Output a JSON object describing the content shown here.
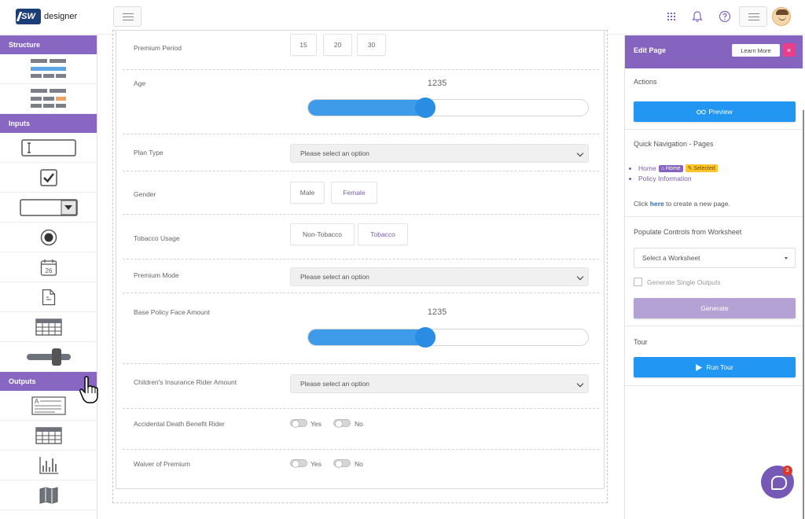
{
  "app": {
    "logo_mark": "SW",
    "logo_text": "designer"
  },
  "toolbox": {
    "sections": {
      "structure": "Structure",
      "inputs": "Inputs",
      "outputs": "Outputs"
    },
    "items": {
      "date_day": "26"
    }
  },
  "form": {
    "premium_period": {
      "label": "Premium Period",
      "options": [
        "15",
        "20",
        "30"
      ]
    },
    "age": {
      "label": "Age",
      "value": "1235",
      "fill_fraction": 0.4
    },
    "plan_type": {
      "label": "Plan Type",
      "placeholder": "Please select an option"
    },
    "gender": {
      "label": "Gender",
      "options": [
        "Male",
        "Female"
      ]
    },
    "tobacco": {
      "label": "Tobacco Usage",
      "options": [
        "Non-Tobacco",
        "Tobacco"
      ]
    },
    "premium_mode": {
      "label": "Premium Mode",
      "placeholder": "Please select an option"
    },
    "face_amount": {
      "label": "Base Policy Face Amount",
      "value": "1235",
      "fill_fraction": 0.4
    },
    "children_rider": {
      "label": "Children's Insurance Rider Amount",
      "placeholder": "Please select an option"
    },
    "accidental_death": {
      "label": "Accidental Death Benefit Rider",
      "yes": "Yes",
      "no": "No"
    },
    "waiver": {
      "label": "Waiver of Premium",
      "yes": "Yes",
      "no": "No"
    }
  },
  "panel": {
    "title": "Edit Page",
    "learn_more": "Learn More",
    "close": "×",
    "actions": {
      "title": "Actions",
      "preview": "Preview"
    },
    "quick_nav": {
      "title": "Quick Navigation - Pages",
      "pages": [
        {
          "label": "Home",
          "home_badge": "Home",
          "selected_badge": "Selected"
        },
        {
          "label": "Policy Information"
        }
      ],
      "create_prefix": "Click ",
      "create_link": "here",
      "create_suffix": " to create a new page."
    },
    "populate": {
      "title": "Populate Controls from Worksheet",
      "select_placeholder": "Select a Worksheet",
      "checkbox_label": "Generate Single Outputs",
      "generate": "Generate"
    },
    "tour": {
      "title": "Tour",
      "run": "Run Tour"
    }
  },
  "chat": {
    "unread": "3"
  },
  "colors": {
    "purple": "#8464bf",
    "blue": "#2196f3",
    "slider_blue": "#3d9be9",
    "badge_yellow": "#ffc52b",
    "close_pink": "#e83e8c"
  }
}
